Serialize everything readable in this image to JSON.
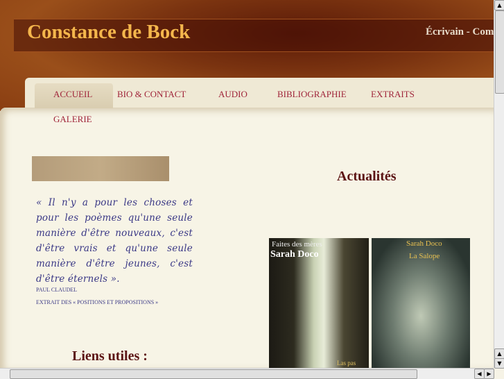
{
  "header": {
    "title": "Constance de Bock",
    "tagline": "Écrivain - Com"
  },
  "nav": {
    "items": [
      "ACCUEIL",
      "BIO & CONTACT",
      "AUDIO",
      "BIBLIOGRAPHIE",
      "EXTRAITS",
      "GALERIE"
    ]
  },
  "quote": {
    "text": "« Il n'y a pour les choses et pour les poèmes qu'une seule manière d'être nouveaux, c'est d'être vrais et qu'une seule manière d'être jeunes, c'est d'être éternels ».",
    "author": "PAUL CLAUDEL",
    "source": "EXTRAIT DES « POSITIONS ET PROPOSITIONS »"
  },
  "news": {
    "heading": "Actualités",
    "covers": [
      {
        "subtitle": "Faites des mères",
        "author": "Sarah Doco",
        "footer": "Las pas"
      },
      {
        "author": "Sarah Doco",
        "title": "La Salope"
      }
    ]
  },
  "links": {
    "heading": "Liens utiles :"
  }
}
